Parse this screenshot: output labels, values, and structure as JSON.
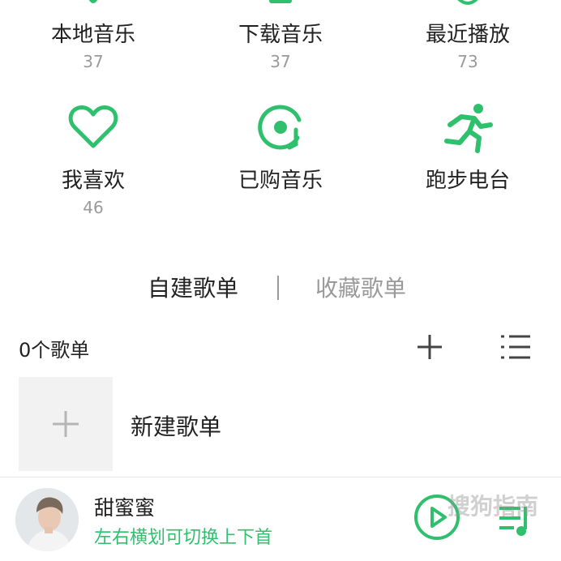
{
  "shortcuts": [
    {
      "label": "本地音乐",
      "count": "37"
    },
    {
      "label": "下载音乐",
      "count": "37"
    },
    {
      "label": "最近播放",
      "count": "73"
    },
    {
      "label": "我喜欢",
      "count": "46"
    },
    {
      "label": "已购音乐",
      "count": ""
    },
    {
      "label": "跑步电台",
      "count": ""
    }
  ],
  "tabs": {
    "active": "自建歌单",
    "inactive": "收藏歌单"
  },
  "playlists": {
    "count_label": "0个歌单",
    "new_label": "新建歌单"
  },
  "player": {
    "song_title": "甜蜜蜜",
    "hint": "左右横划可切换上下首",
    "watermark": "搜狗指南"
  },
  "colors": {
    "accent": "#2fc06e",
    "muted": "#9a9a9a"
  },
  "icons": {
    "heart": "heart-icon",
    "disc": "purchased-disc-icon",
    "runner": "running-icon",
    "add": "plus-icon",
    "menu": "list-menu-icon",
    "play": "play-icon",
    "queue": "playlist-queue-icon"
  }
}
